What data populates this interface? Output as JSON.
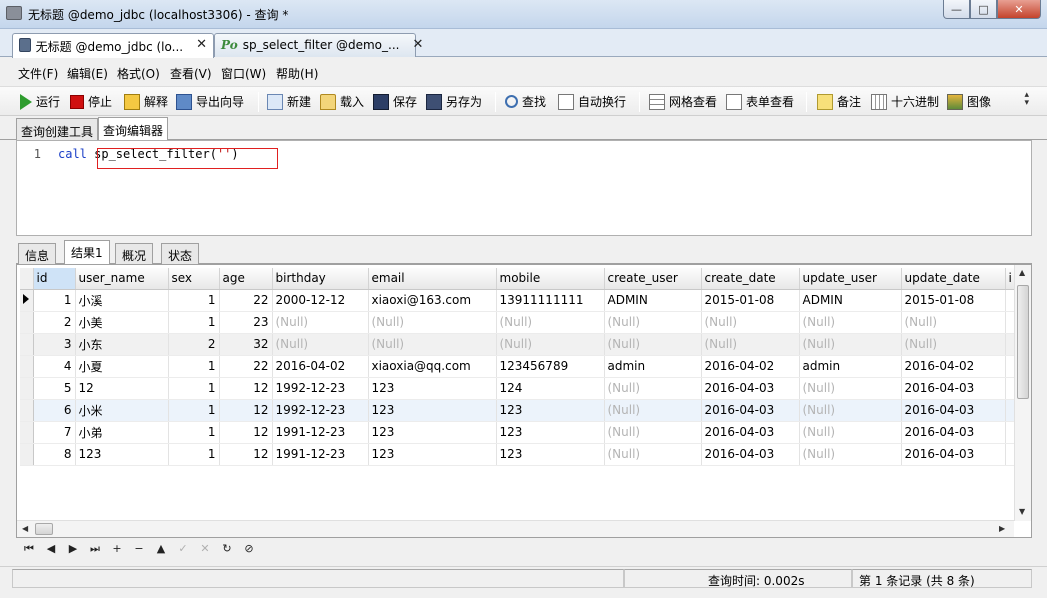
{
  "window": {
    "title": "无标题 @demo_jdbc (localhost3306) - 查询 *",
    "minimize": "—",
    "maximize": "□",
    "close": "✕"
  },
  "doc_tabs": [
    {
      "label": "无标题 @demo_jdbc (lo...",
      "icon": "query-icon",
      "active": true,
      "close": "✕"
    },
    {
      "label": "sp_select_filter @demo_...",
      "icon": "procedure-icon",
      "icon_text": "Po",
      "active": false,
      "close": "✕"
    }
  ],
  "menu": [
    "文件(F)",
    "编辑(E)",
    "格式(O)",
    "查看(V)",
    "窗口(W)",
    "帮助(H)"
  ],
  "toolbar": {
    "run": "运行",
    "stop": "停止",
    "explain": "解释",
    "export_wizard": "导出向导",
    "new": "新建",
    "load": "载入",
    "save": "保存",
    "save_as": "另存为",
    "find": "查找",
    "word_wrap": "自动换行",
    "grid_view": "网格查看",
    "form_view": "表单查看",
    "memo": "备注",
    "hex": "十六进制",
    "image": "图像",
    "overflow": "»"
  },
  "sub_tabs": [
    "查询创建工具",
    "查询编辑器"
  ],
  "editor": {
    "line_number": "1",
    "keyword": "call",
    "proc": " sp_select_filter(",
    "string": "''",
    "close_paren": ")"
  },
  "result_tabs": [
    "信息",
    "结果1",
    "概况",
    "状态"
  ],
  "grid": {
    "columns": [
      "id",
      "user_name",
      "sex",
      "age",
      "birthday",
      "email",
      "mobile",
      "create_user",
      "create_date",
      "update_user",
      "update_date",
      "i"
    ],
    "rows": [
      [
        "1",
        "小溪",
        "1",
        "22",
        "2000-12-12",
        "xiaoxi@163.com",
        "13911111111",
        "ADMIN",
        "2015-01-08",
        "ADMIN",
        "2015-01-08"
      ],
      [
        "2",
        "小美",
        "1",
        "23",
        "(Null)",
        "(Null)",
        "(Null)",
        "(Null)",
        "(Null)",
        "(Null)",
        "(Null)"
      ],
      [
        "3",
        "小东",
        "2",
        "32",
        "(Null)",
        "(Null)",
        "(Null)",
        "(Null)",
        "(Null)",
        "(Null)",
        "(Null)"
      ],
      [
        "4",
        "小夏",
        "1",
        "22",
        "2016-04-02",
        "xiaoxia@qq.com",
        "123456789",
        "admin",
        "2016-04-02",
        "admin",
        "2016-04-02"
      ],
      [
        "5",
        "12",
        "1",
        "12",
        "1992-12-23",
        "123",
        "124",
        "(Null)",
        "2016-04-03",
        "(Null)",
        "2016-04-03"
      ],
      [
        "6",
        "小米",
        "1",
        "12",
        "1992-12-23",
        "123",
        "123",
        "(Null)",
        "2016-04-03",
        "(Null)",
        "2016-04-03"
      ],
      [
        "7",
        "小弟",
        "1",
        "12",
        "1991-12-23",
        "123",
        "123",
        "(Null)",
        "2016-04-03",
        "(Null)",
        "2016-04-03"
      ],
      [
        "8",
        "123",
        "1",
        "12",
        "1991-12-23",
        "123",
        "123",
        "(Null)",
        "2016-04-03",
        "(Null)",
        "2016-04-03"
      ]
    ]
  },
  "nav_buttons": [
    {
      "name": "first-record-button",
      "glyph": "⏮"
    },
    {
      "name": "prev-record-button",
      "glyph": "◀"
    },
    {
      "name": "next-record-button",
      "glyph": "▶"
    },
    {
      "name": "last-record-button",
      "glyph": "⏭"
    },
    {
      "name": "add-record-button",
      "glyph": "+"
    },
    {
      "name": "delete-record-button",
      "glyph": "−"
    },
    {
      "name": "edit-record-button",
      "glyph": "▲"
    },
    {
      "name": "apply-changes-button",
      "glyph": "✓",
      "disabled": true
    },
    {
      "name": "discard-changes-button",
      "glyph": "✕",
      "disabled": true
    },
    {
      "name": "refresh-button",
      "glyph": "↻"
    },
    {
      "name": "stop-button",
      "glyph": "⊘"
    }
  ],
  "status": {
    "query_time": "查询时间: 0.002s",
    "record_info": "第 1 条记录 (共 8 条)"
  }
}
